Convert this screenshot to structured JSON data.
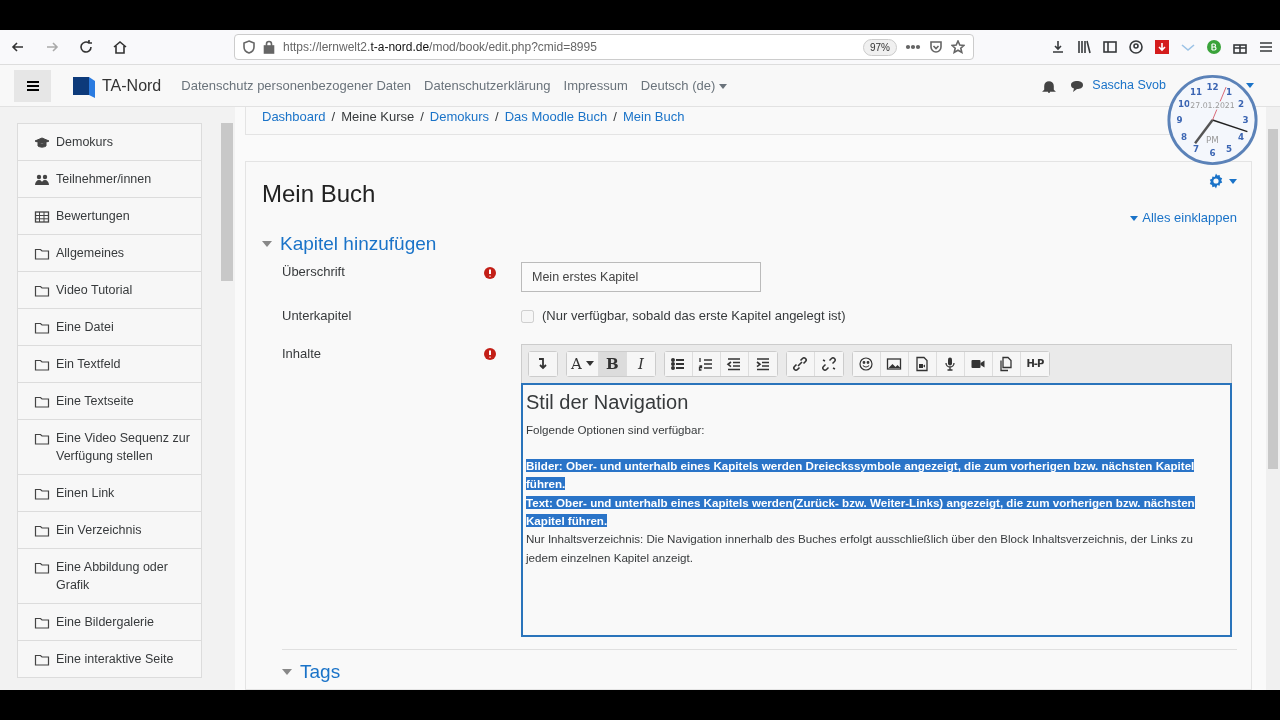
{
  "browser": {
    "url": {
      "prefix": "https://lernwelt2.",
      "domain": "t-a-nord.de",
      "path": "/mod/book/edit.php?cmid=8995"
    },
    "zoom": "97%"
  },
  "navbar": {
    "brand": "TA-Nord",
    "links": [
      "Datenschutz personenbezogener Daten",
      "Datenschutzerklärung",
      "Impressum"
    ],
    "language": "Deutsch (de)",
    "user": "Sascha Svob"
  },
  "clock": {
    "numerals": [
      "12",
      "11",
      "1",
      "10",
      "2",
      "9",
      "3",
      "8",
      "4",
      "7",
      "5",
      "6"
    ],
    "date": "27.01.2021",
    "period": "PM"
  },
  "sidebar": {
    "items": [
      {
        "label": "Demokurs",
        "kind": "course"
      },
      {
        "label": "Teilnehmer/innen",
        "kind": "users"
      },
      {
        "label": "Bewertungen",
        "kind": "grades"
      },
      {
        "label": "Allgemeines",
        "kind": "folder"
      },
      {
        "label": "Video Tutorial",
        "kind": "folder"
      },
      {
        "label": "Eine Datei",
        "kind": "folder"
      },
      {
        "label": "Ein Textfeld",
        "kind": "folder"
      },
      {
        "label": "Eine Textseite",
        "kind": "folder"
      },
      {
        "label": "Eine Video Sequenz zur Verfügung stellen",
        "kind": "folder"
      },
      {
        "label": "Einen Link",
        "kind": "folder"
      },
      {
        "label": "Ein Verzeichnis",
        "kind": "folder"
      },
      {
        "label": "Eine Abbildung oder Grafik",
        "kind": "folder"
      },
      {
        "label": "Eine Bildergalerie",
        "kind": "folder"
      },
      {
        "label": "Eine interaktive Seite",
        "kind": "folder"
      }
    ]
  },
  "breadcrumb": [
    {
      "label": "Dashboard",
      "link": true
    },
    {
      "separator": "/"
    },
    {
      "label": "Meine Kurse",
      "link": false
    },
    {
      "separator": "/"
    },
    {
      "label": "Demokurs",
      "link": true
    },
    {
      "separator": "/"
    },
    {
      "label": "Das Moodle Buch",
      "link": true
    },
    {
      "separator": "/"
    },
    {
      "label": "Mein Buch",
      "link": true
    }
  ],
  "page": {
    "title": "Mein Buch",
    "collapse_all": "Alles einklappen",
    "section": {
      "title": "Kapitel hinzufügen",
      "expanded": true,
      "fields": [
        {
          "kind": "text",
          "label": "Überschrift",
          "required": true,
          "value": "Mein erstes Kapitel"
        },
        {
          "kind": "checkbox",
          "label": "Unterkapitel",
          "required": false,
          "checked": false,
          "text": "(Nur verfügbar, sobald das erste Kapitel angelegt ist)"
        },
        {
          "kind": "editor",
          "label": "Inhalte",
          "required": true
        }
      ]
    },
    "editor": {
      "toolbar": [
        [
          {
            "kind": "collapse",
            "active": false
          }
        ],
        [
          {
            "kind": "font",
            "text": "A",
            "caret": true,
            "active": false
          },
          {
            "kind": "bold",
            "text": "B",
            "active": true
          },
          {
            "kind": "italic",
            "text": "I",
            "active": false
          }
        ],
        [
          {
            "kind": "bullets",
            "active": false
          },
          {
            "kind": "numbers",
            "active": false
          },
          {
            "kind": "outdent",
            "active": false
          },
          {
            "kind": "indent",
            "active": false
          }
        ],
        [
          {
            "kind": "link",
            "active": false
          },
          {
            "kind": "unlink",
            "active": false
          }
        ],
        [
          {
            "kind": "emoji",
            "active": false
          },
          {
            "kind": "image",
            "active": false
          },
          {
            "kind": "media",
            "active": false
          },
          {
            "kind": "mic",
            "active": false
          },
          {
            "kind": "video",
            "active": false
          },
          {
            "kind": "files",
            "active": false
          },
          {
            "kind": "logo",
            "text": "H-P",
            "active": false
          }
        ]
      ],
      "content": [
        {
          "kind": "heading",
          "text": "Stil der Navigation",
          "selected": false
        },
        {
          "kind": "paragraph",
          "text": "Folgende Optionen sind verfügbar:",
          "selected": false
        },
        {
          "kind": "line",
          "text": "Bilder: Ober- und unterhalb eines Kapitels werden Dreieckssymbole angezeigt, die zum vorherigen bzw. nächsten Kapitel führen.",
          "selected": true
        },
        {
          "kind": "line",
          "text": "Text: Ober- und unterhalb eines Kapitels werden(Zurück- bzw. Weiter-Links) angezeigt, die zum vorherigen bzw. nächsten Kapitel führen.",
          "selected": true
        },
        {
          "kind": "line",
          "text": "Nur Inhaltsverzeichnis: Die Navigation innerhalb des Buches erfolgt ausschließlich über den Block Inhaltsverzeichnis, der Links zu jedem einzelnen Kapitel anzeigt.",
          "selected": false
        }
      ]
    },
    "next_section": {
      "title": "Tags",
      "expanded": true
    }
  }
}
